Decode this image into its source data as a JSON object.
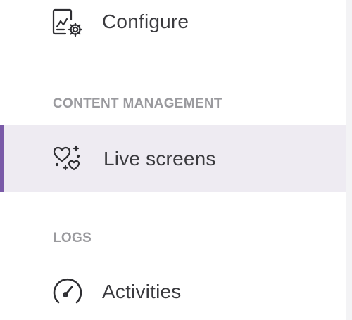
{
  "sidebar": {
    "items_top": [
      {
        "label": "Configure",
        "icon": "configure-icon"
      }
    ],
    "sections": [
      {
        "header": "CONTENT MANAGEMENT",
        "items": [
          {
            "label": "Live screens",
            "icon": "hearts-sparkle-icon",
            "active": true
          }
        ]
      },
      {
        "header": "LOGS",
        "items": [
          {
            "label": "Activities",
            "icon": "gauge-icon"
          }
        ]
      }
    ]
  },
  "colors": {
    "active_background": "#eeebf2",
    "active_indicator": "#7a5aa8",
    "label_text": "#3a3a3e",
    "section_header_text": "#9a9a9e"
  }
}
